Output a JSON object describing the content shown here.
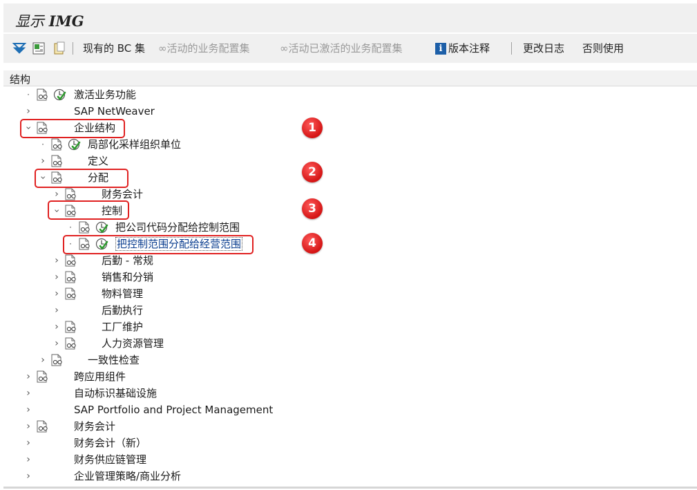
{
  "window": {
    "title_prefix": "显示 ",
    "title_bold": "IMG"
  },
  "toolbar": {
    "bc_sets": "现有的 BC 集",
    "active_config": "活动的业务配置集",
    "activated_config": "活动已激活的业务配置集",
    "release_notes": "版本注释",
    "change_log": "更改日志",
    "where_used": "否则使用"
  },
  "structure": {
    "header": "结构",
    "rows": [
      {
        "label": "激活业务功能"
      },
      {
        "label": "SAP NetWeaver"
      },
      {
        "label": "企业结构"
      },
      {
        "label": "局部化采样组织单位"
      },
      {
        "label": "定义"
      },
      {
        "label": "分配"
      },
      {
        "label": "财务会计"
      },
      {
        "label": "控制"
      },
      {
        "label": "把公司代码分配给控制范围"
      },
      {
        "label": "把控制范围分配给经营范围"
      },
      {
        "label": "后勤 - 常规"
      },
      {
        "label": "销售和分销"
      },
      {
        "label": "物料管理"
      },
      {
        "label": "后勤执行"
      },
      {
        "label": "工厂维护"
      },
      {
        "label": "人力资源管理"
      },
      {
        "label": "一致性检查"
      },
      {
        "label": "跨应用组件"
      },
      {
        "label": "自动标识基础设施"
      },
      {
        "label": "SAP Portfolio and Project Management"
      },
      {
        "label": "财务会计"
      },
      {
        "label": "财务会计（新）"
      },
      {
        "label": "财务供应链管理"
      },
      {
        "label": "企业管理策略/商业分析"
      }
    ]
  },
  "annotations": {
    "step1": "1",
    "step2": "2",
    "step3": "3",
    "step4": "4"
  },
  "colors": {
    "highlight": "#e02020",
    "badge": "#d41414",
    "selected_text": "#0a3d8f"
  }
}
